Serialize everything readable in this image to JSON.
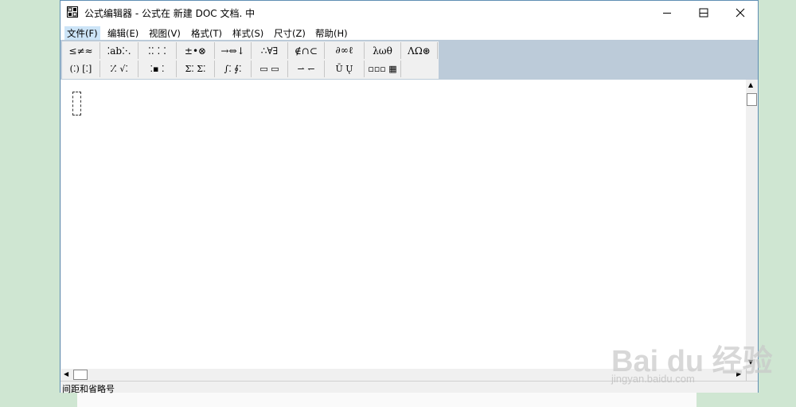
{
  "window": {
    "title": "公式编辑器 - 公式在 新建 DOC 文档. 中",
    "controls": {
      "minimize": "minimize-icon",
      "maximize": "maximize-icon",
      "close": "close-icon"
    }
  },
  "menu": [
    {
      "label": "文件(F)"
    },
    {
      "label": "编辑(E)"
    },
    {
      "label": "视图(V)"
    },
    {
      "label": "格式(T)"
    },
    {
      "label": "样式(S)"
    },
    {
      "label": "尺寸(Z)"
    },
    {
      "label": "帮助(H)"
    }
  ],
  "palette": {
    "row1": [
      {
        "label": "≤≠≈"
      },
      {
        "label": "⁚ab⁚·."
      },
      {
        "label": "⁚⁚ ⁚ ⁚"
      },
      {
        "label": "±•⊗"
      },
      {
        "label": "→⇔↓"
      },
      {
        "label": "∴∀∃"
      },
      {
        "label": "∉∩⊂"
      },
      {
        "label": "∂∞ℓ"
      },
      {
        "label": "λωθ"
      },
      {
        "label": "ΛΩ⊛"
      }
    ],
    "row2": [
      {
        "label": "(⁚) [⁚]"
      },
      {
        "label": "⁚⁄⁚ √⁚"
      },
      {
        "label": "⁚▪ ⁚"
      },
      {
        "label": "Σ⁚ Σ⁚"
      },
      {
        "label": "∫⁚ ∮⁚"
      },
      {
        "label": "▭ ▭"
      },
      {
        "label": "⇀ ↽"
      },
      {
        "label": "Ū Ų"
      },
      {
        "label": "▫▫▫ ▦"
      }
    ]
  },
  "status": {
    "text": "间距和省略号"
  },
  "watermark": {
    "brand": "Bai du 经验",
    "url": "jingyan.baidu.com"
  },
  "colors": {
    "desktop": "#cfe6d2",
    "window_border": "#5f8eb3",
    "toolbar_band": "#bccbd9",
    "menu_highlight": "#cce4f7"
  }
}
